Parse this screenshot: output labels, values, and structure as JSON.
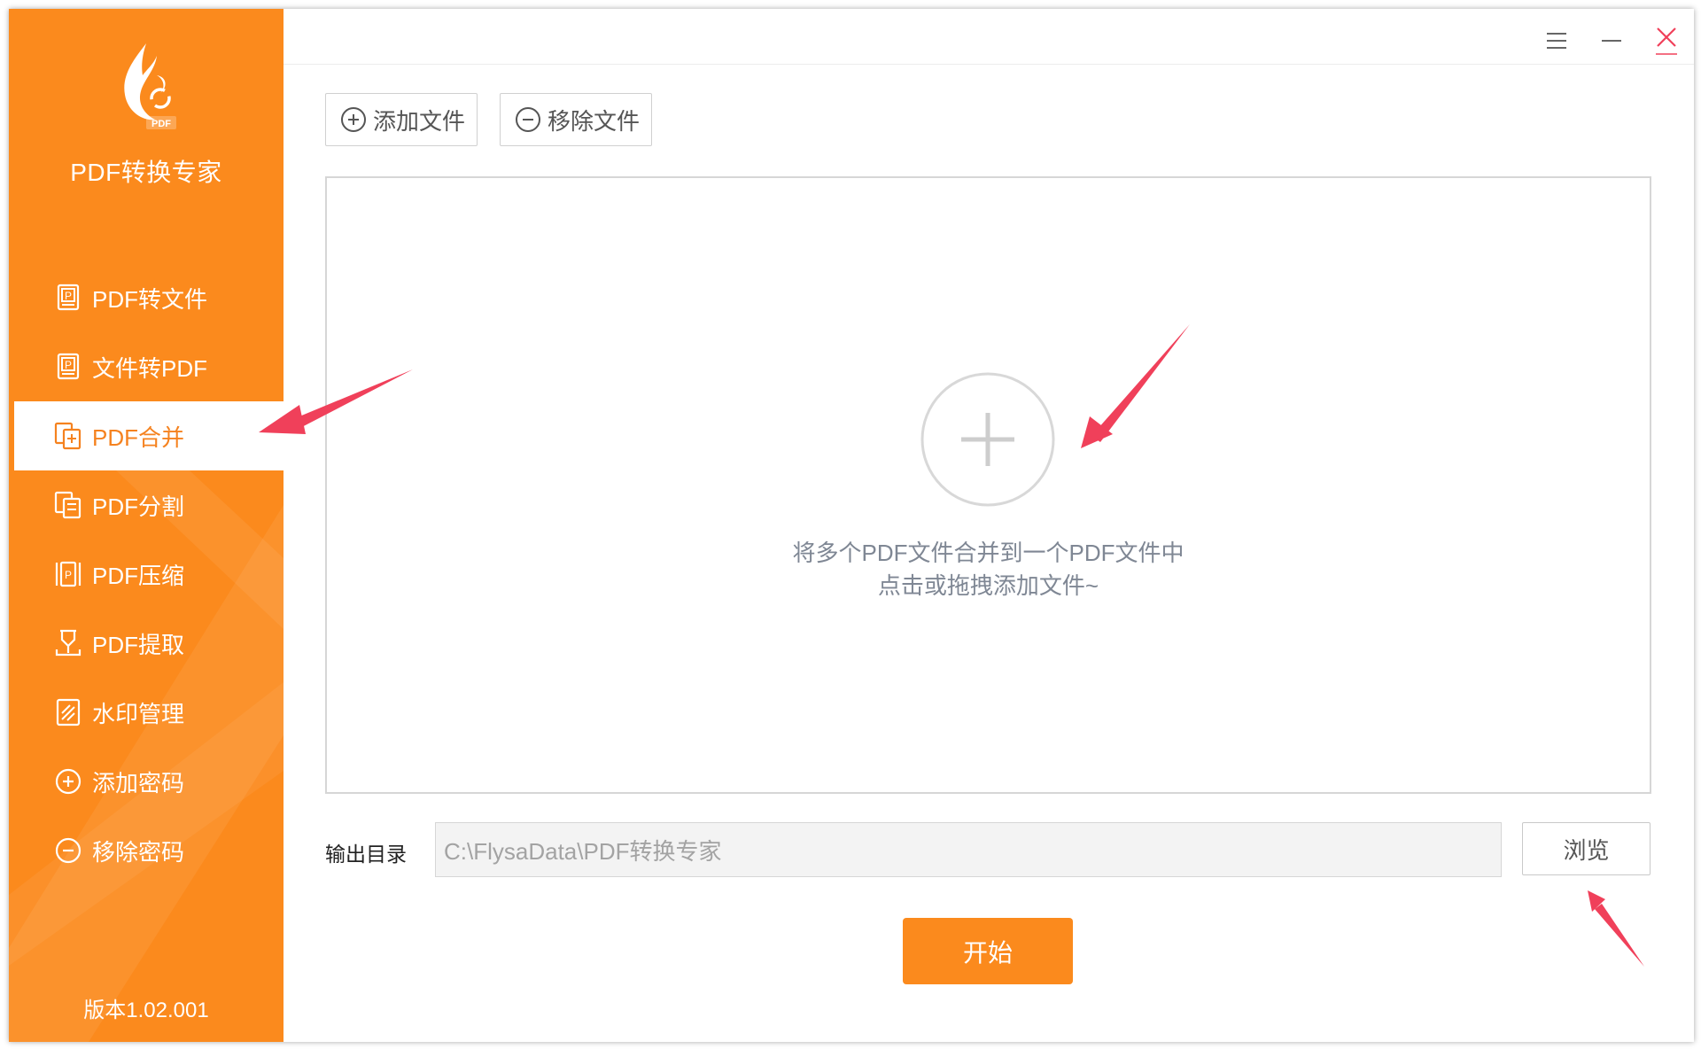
{
  "app": {
    "name": "PDF转换专家",
    "logo_text": "PDF",
    "version": "版本1.02.001"
  },
  "sidebar": {
    "items": [
      {
        "label": "PDF转文件",
        "icon": "pdf-to-file-icon",
        "active": false
      },
      {
        "label": "文件转PDF",
        "icon": "file-to-pdf-icon",
        "active": false
      },
      {
        "label": "PDF合并",
        "icon": "merge-icon",
        "active": true
      },
      {
        "label": "PDF分割",
        "icon": "split-icon",
        "active": false
      },
      {
        "label": "PDF压缩",
        "icon": "compress-icon",
        "active": false
      },
      {
        "label": "PDF提取",
        "icon": "extract-icon",
        "active": false
      },
      {
        "label": "水印管理",
        "icon": "watermark-icon",
        "active": false
      },
      {
        "label": "添加密码",
        "icon": "add-password-icon",
        "active": false
      },
      {
        "label": "移除密码",
        "icon": "remove-password-icon",
        "active": false
      }
    ]
  },
  "toolbar": {
    "add_label": "添加文件",
    "remove_label": "移除文件"
  },
  "dropzone": {
    "hint_line1": "将多个PDF文件合并到一个PDF文件中",
    "hint_line2": "点击或拖拽添加文件~"
  },
  "output": {
    "label": "输出目录",
    "path": "C:\\FlysaData\\PDF转换专家",
    "browse_label": "浏览"
  },
  "start_label": "开始",
  "colors": {
    "accent": "#fb8a1d",
    "annotation": "#f0405a"
  }
}
